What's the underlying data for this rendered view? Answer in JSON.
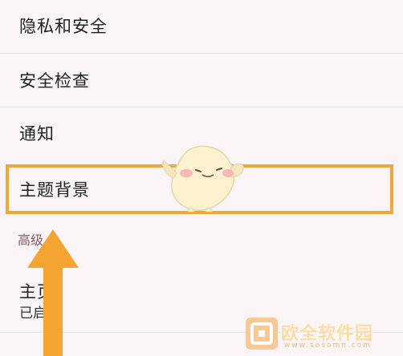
{
  "settings": {
    "items": [
      {
        "label": "隐私和安全"
      },
      {
        "label": "安全检查"
      },
      {
        "label": "通知"
      },
      {
        "label": "主题背景"
      }
    ],
    "section_header": "高级",
    "advanced_items": [
      {
        "label": "主页",
        "sub": "已启用"
      }
    ]
  },
  "watermark": {
    "text": "欧全软件园",
    "url": "www.sosomn.com"
  },
  "colors": {
    "highlight": "#eea83c",
    "arrow": "#f5a431",
    "background": "#fbf5f7"
  }
}
